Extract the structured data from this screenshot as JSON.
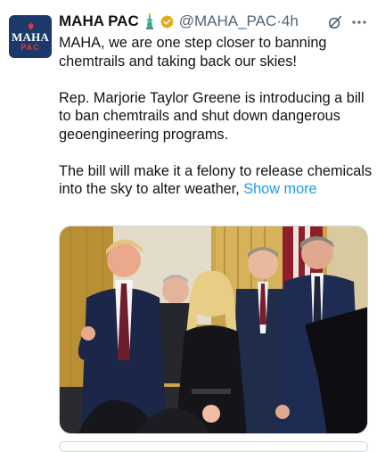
{
  "tweet": {
    "author": {
      "name": "MAHA PAC",
      "handle": "@MAHA_PAC",
      "separator": "·",
      "time": "4h",
      "avatar_text_line1": "MAHA",
      "avatar_text_line2": "PAC"
    },
    "badges": [
      "statue-of-liberty-emoji",
      "verified-gold-badge"
    ],
    "body": {
      "paragraph1": "MAHA, we are one step closer to banning chemtrails and taking back our skies!",
      "paragraph2": "Rep. Marjorie Taylor Greene is introducing a bill to ban chemtrails and shut down dangerous geoengineering programs.",
      "paragraph3": "The bill will make it a felony to release chemicals into the sky to alter weather, ",
      "show_more": "Show more"
    },
    "icons": [
      "grok-icon",
      "more-options-icon"
    ],
    "colors": {
      "link": "#1d9bf0",
      "secondary_text": "#536471",
      "avatar_bg": "#1b3a6b",
      "avatar_accent": "#e8343a",
      "verified_gold": "#e2a91b"
    }
  }
}
